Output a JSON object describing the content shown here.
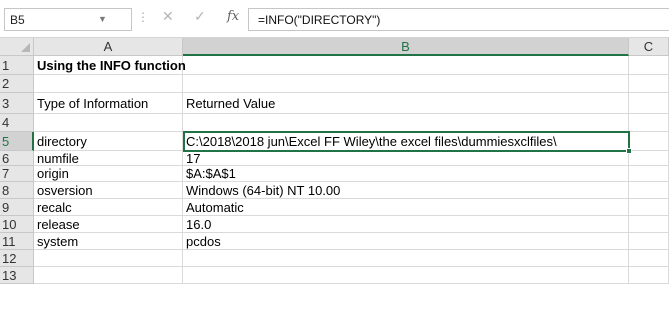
{
  "formula_bar": {
    "name_box": "B5",
    "cancel_icon": "✕",
    "enter_icon": "✓",
    "fx_label": "fx",
    "formula": "=INFO(\"DIRECTORY\")"
  },
  "columns": [
    "A",
    "B",
    "C"
  ],
  "rows": [
    {
      "n": "1",
      "a": "Using the INFO function",
      "b": ""
    },
    {
      "n": "2",
      "a": "",
      "b": ""
    },
    {
      "n": "3",
      "a": "Type of Information",
      "b": "Returned Value"
    },
    {
      "n": "4",
      "a": "",
      "b": ""
    },
    {
      "n": "5",
      "a": "directory",
      "b": "C:\\2018\\2018  jun\\Excel FF Wiley\\the excel files\\dummiesxclfiles\\"
    },
    {
      "n": "6",
      "a": "numfile",
      "b": "17"
    },
    {
      "n": "7",
      "a": "origin",
      "b": "$A:$A$1"
    },
    {
      "n": "8",
      "a": "osversion",
      "b": "Windows (64-bit) NT 10.00"
    },
    {
      "n": "9",
      "a": "recalc",
      "b": "Automatic"
    },
    {
      "n": "10",
      "a": "release",
      "b": "16.0"
    },
    {
      "n": "11",
      "a": "system",
      "b": "pcdos"
    },
    {
      "n": "12",
      "a": "",
      "b": ""
    },
    {
      "n": "13",
      "a": "",
      "b": ""
    }
  ],
  "colors": {
    "accent": "#217346",
    "header_bg": "#e6e6e6",
    "gridline": "#dadada"
  }
}
